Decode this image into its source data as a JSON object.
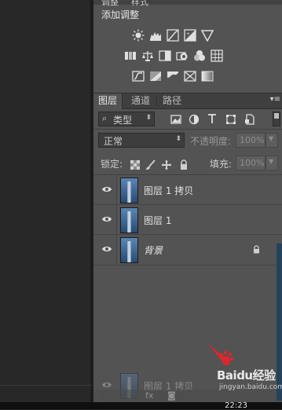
{
  "adjustments": {
    "top_tab_1": "调整",
    "top_tab_2": "样式",
    "title": "添加调整"
  },
  "layers_panel": {
    "tabs": [
      "图层",
      "通道",
      "路径"
    ],
    "filter_kind": "类型",
    "blend_mode": "正常",
    "opacity_label": "不透明度:",
    "opacity_value": "100%",
    "lock_label": "锁定:",
    "fill_label": "填充:",
    "fill_value": "100%",
    "layers": [
      {
        "name": "图层 1 拷贝",
        "visible": true,
        "locked": false
      },
      {
        "name": "图层 1",
        "visible": true,
        "locked": false
      },
      {
        "name": "背景",
        "visible": true,
        "locked": true
      }
    ],
    "drag_ghost_name": "图层 1 拷贝"
  },
  "bottom_bar": {
    "fx_label": "fx"
  },
  "watermark": {
    "brand": "Baidu经验",
    "url": "jingyan.baidu.com"
  },
  "taskbar": {
    "clock": "22:23"
  },
  "colors": {
    "panel_bg": "#535353",
    "tab_bar": "#3f3f3f",
    "canvas_bg": "#282828",
    "accent_red": "#e0262d"
  }
}
